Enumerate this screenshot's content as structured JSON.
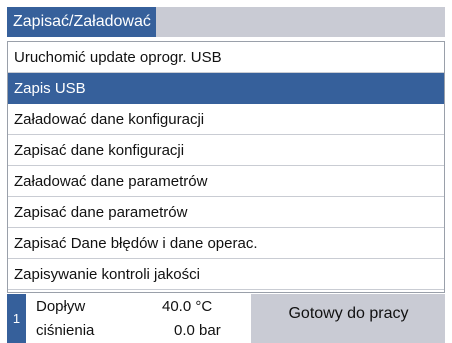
{
  "title": "Zapisać/Załadować",
  "menu": {
    "items": [
      {
        "label": "Uruchomić update oprogr. USB",
        "selected": false
      },
      {
        "label": "Zapis USB",
        "selected": true
      },
      {
        "label": "Załadować dane konfiguracji",
        "selected": false
      },
      {
        "label": "Zapisać dane konfiguracji",
        "selected": false
      },
      {
        "label": "Załadować dane parametrów",
        "selected": false
      },
      {
        "label": "Zapisać dane parametrów",
        "selected": false
      },
      {
        "label": "Zapisać Dane błędów i dane operac.",
        "selected": false
      },
      {
        "label": "Zapisywanie kontroli jakości",
        "selected": false
      }
    ]
  },
  "status": {
    "number": "1",
    "row1_label": "Dopływ",
    "row1_value": "40.0 °C",
    "row2_label": "ciśnienia",
    "row2_value": "0.0 bar",
    "state": "Gotowy do pracy"
  },
  "colors": {
    "accent": "#36609b",
    "bar": "#c9cbd4"
  }
}
